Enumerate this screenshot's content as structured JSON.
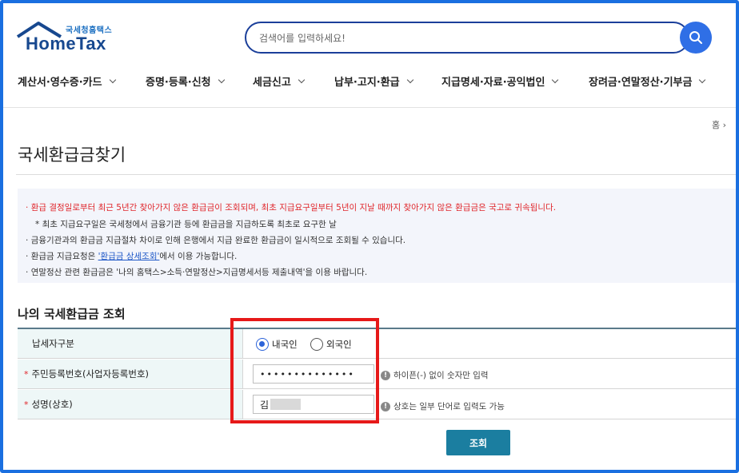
{
  "header": {
    "logo_sub": "국세청홈택스",
    "logo_main": "HomeTax",
    "search_placeholder": "검색어를 입력하세요!"
  },
  "nav": {
    "items": [
      {
        "label": "계산서·영수증·카드"
      },
      {
        "label": "증명·등록·신청"
      },
      {
        "label": "세금신고"
      },
      {
        "label": "납부·고지·환급"
      },
      {
        "label": "지급명세·자료·공익법인"
      },
      {
        "label": "장려금·연말정산·기부금"
      }
    ]
  },
  "breadcrumb": {
    "home": "홈",
    "separator": "›"
  },
  "page_title": "국세환급금찾기",
  "notice": {
    "line1": "환급 결정일로부터 최근 5년간 찾아가지 않은 환급금이 조회되며, 최초 지급요구일부터 5년이 지날 때까지 찾아가지 않은 환급금은 국고로 귀속됩니다.",
    "line2": "* 최초 지급요구일은 국세청에서 금융기관 등에 환급금을 지급하도록 최초로 요구한 날",
    "line3": "금융기관과의 환급금 지급절차 차이로 인해 은행에서 지급 완료한 환급금이 일시적으로 조회될 수 있습니다.",
    "line4_pre": "환급금 지급요청은 ",
    "line4_link": "'환급금 상세조회'",
    "line4_post": "에서 이용 가능합니다.",
    "line5": "연말정산 관련 환급금은 '나의 홈택스>소득·연말정산>지급명세서등 제출내역'을 이용 바랍니다."
  },
  "section_title": "나의 국세환급금 조회",
  "form": {
    "taxpayer_type_label": "납세자구분",
    "domestic_label": "내국인",
    "foreign_label": "외국인",
    "selected": "domestic",
    "id_label": "주민등록번호(사업자등록번호)",
    "id_value": "••••••••••••••",
    "id_hint": "하이픈(-) 없이 숫자만 입력",
    "name_label": "성명(상호)",
    "name_value": "김",
    "name_hint": "상호는 일부 단어로 입력도 가능",
    "required_mark": "*",
    "hint_icon": "!"
  },
  "submit_label": "조회",
  "colors": {
    "accent": "#2f6fe6",
    "frame": "#1a6fe0",
    "highlight": "#e61919",
    "submit": "#1b7ea0",
    "notice_red": "#e0262b"
  }
}
